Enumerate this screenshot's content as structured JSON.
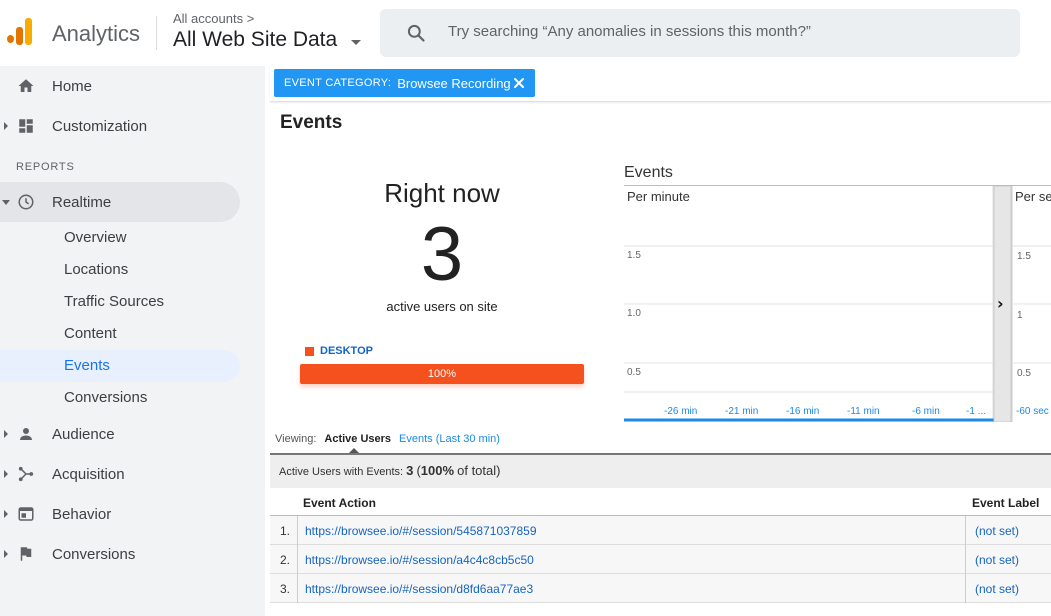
{
  "header": {
    "app_name": "Analytics",
    "account_crumb": "All accounts",
    "account_crumb_chevron": ">",
    "property_name": "All Web Site Data",
    "search_placeholder": "Try searching “Any anomalies in sessions this month?”"
  },
  "sidebar": {
    "items": [
      {
        "label": "Home",
        "icon": "home-icon"
      },
      {
        "label": "Customization",
        "icon": "dashboard-icon"
      }
    ],
    "reports_heading": "REPORTS",
    "realtime": {
      "label": "Realtime",
      "icon": "clock-icon",
      "children": [
        "Overview",
        "Locations",
        "Traffic Sources",
        "Content",
        "Events",
        "Conversions"
      ],
      "active_child": "Events"
    },
    "sections": [
      {
        "label": "Audience",
        "icon": "person-icon"
      },
      {
        "label": "Acquisition",
        "icon": "acquisition-icon"
      },
      {
        "label": "Behavior",
        "icon": "behavior-icon"
      },
      {
        "label": "Conversions",
        "icon": "flag-icon"
      }
    ]
  },
  "filter": {
    "key": "EVENT CATEGORY:",
    "value": "Browsee Recording"
  },
  "page_title": "Events",
  "right_now": {
    "label": "Right now",
    "count": "3",
    "caption": "active users on site",
    "device_label": "DESKTOP",
    "device_percent": "100%",
    "device_fraction": 1.0
  },
  "events_chart": {
    "title": "Events",
    "per_minute_label": "Per minute",
    "per_second_label": "Per se",
    "y_ticks": [
      "1.5",
      "1.0",
      "0.5"
    ],
    "y_ticks_right": [
      "1.5",
      "1",
      "0.5"
    ],
    "x_ticks": [
      "-26 min",
      "-21 min",
      "-16 min",
      "-11 min",
      "-6 min",
      "-1 ..."
    ],
    "x_ticks_right": [
      "-60 sec"
    ],
    "expand_glyph": "›"
  },
  "chart_data": {
    "type": "bar",
    "title": "Events",
    "series": [
      {
        "name": "Per minute",
        "values": [
          0,
          0,
          0,
          0,
          0,
          0,
          0,
          0,
          0,
          0,
          0,
          0,
          0,
          0,
          0,
          0,
          0,
          0,
          0,
          0,
          0,
          0,
          0,
          0,
          0,
          0,
          0,
          0,
          0,
          0
        ]
      }
    ],
    "x_labels": [
      "-26 min",
      "-21 min",
      "-16 min",
      "-11 min",
      "-6 min",
      "-1 ..."
    ],
    "y_ticks": [
      0.5,
      1.0,
      1.5
    ],
    "grid": true
  },
  "viewing": {
    "label": "Viewing:",
    "active_tab": "Active Users",
    "other_tab": "Events (Last 30 min)"
  },
  "summary": {
    "label": "Active Users with Events:",
    "count": "3",
    "pct_open": "(",
    "pct": "100%",
    "pct_suffix": "of total)"
  },
  "table": {
    "headers": [
      "Event Action",
      "Event Label"
    ],
    "rows": [
      {
        "num": "1.",
        "action": "https://browsee.io/#/session/545871037859",
        "label": "(not set)"
      },
      {
        "num": "2.",
        "action": "https://browsee.io/#/session/a4c4c8cb5c50",
        "label": "(not set)"
      },
      {
        "num": "3.",
        "action": "https://browsee.io/#/session/d8fd6aa77ae3",
        "label": "(not set)"
      }
    ]
  },
  "colors": {
    "accent": "#1a73e8",
    "chip": "#2196f3",
    "device_bar": "#f4511e",
    "sidebar_bg": "#f1f3f4",
    "link": "#1565c0"
  }
}
